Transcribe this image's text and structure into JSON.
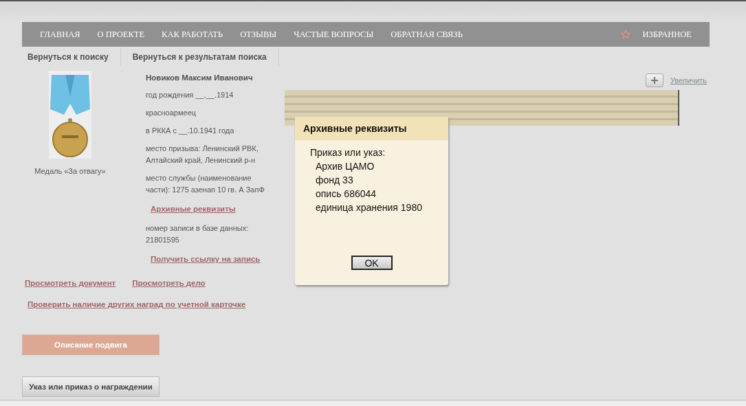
{
  "nav": {
    "items": [
      "ГЛАВНАЯ",
      "О ПРОЕКТЕ",
      "КАК РАБОТАТЬ",
      "ОТЗЫВЫ",
      "ЧАСТЫЕ ВОПРОСЫ",
      "ОБРАТНАЯ СВЯЗЬ"
    ],
    "favorites": "ИЗБРАННОЕ"
  },
  "back_links": [
    "Вернуться к поиску",
    "Вернуться к результатам поиска"
  ],
  "award": {
    "caption": "Медаль «За отвагу»"
  },
  "person": {
    "name": "Новиков Максим Иванович",
    "fields": [
      {
        "kind": "text",
        "text": "год рождения __.__.1914"
      },
      {
        "kind": "text",
        "text": "красноармеец"
      },
      {
        "kind": "text",
        "text": "в РККА с __.10.1941 года"
      },
      {
        "kind": "text",
        "text": "место призыва: Ленинский РВК, Алтайский край, Ленинский р-н"
      },
      {
        "kind": "text",
        "text": "место службы (наименование части): 1275 азенап 10 гв. А ЗапФ"
      },
      {
        "kind": "link",
        "text": "Архивные реквизиты"
      },
      {
        "kind": "text",
        "text": "номер записи в базе данных: 21801595"
      },
      {
        "kind": "link",
        "text": "Получить ссылку на запись"
      }
    ]
  },
  "zoom_link": "Увеличить",
  "doc_links": [
    "Просмотреть документ",
    "Просмотреть дело"
  ],
  "check_link": "Проверить наличие других наград по учетной карточке",
  "buttons": [
    {
      "label": "Описание подвига",
      "selected": true
    },
    {
      "label": "Указ или приказ о награждении",
      "selected": false
    }
  ],
  "dialog": {
    "title": "Архивные реквизиты",
    "heading": "Приказ или указ:",
    "lines": [
      "Архив ЦАМО",
      "фонд 33",
      "опись 686044",
      "единица хранения 1980"
    ],
    "ok": "OK"
  }
}
